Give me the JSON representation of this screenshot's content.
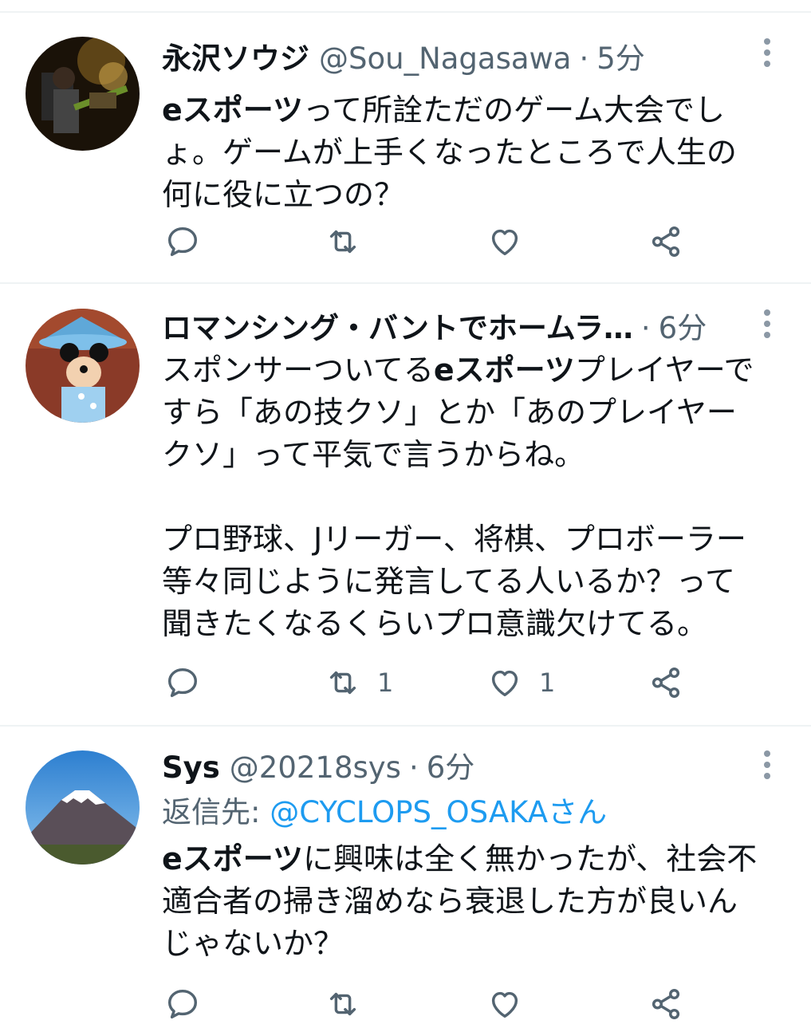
{
  "tweets": [
    {
      "display_name": "永沢ソウジ",
      "handle": "@Sou_Nagasawa",
      "separator": "·",
      "time": "5分",
      "reply_label": "",
      "reply_handle": "",
      "lines": [
        [
          {
            "t": "eスポーツ",
            "b": true
          },
          {
            "t": "って所詮ただのゲーム大会でし",
            "b": false
          }
        ],
        [
          {
            "t": "ょ。ゲームが上手くなったところで人生の",
            "b": false
          }
        ],
        [
          {
            "t": "何に役に立つの？",
            "b": false
          }
        ]
      ],
      "counts": {
        "reply": "",
        "retweet": "",
        "like": ""
      }
    },
    {
      "display_name": "ロマンシング・バントでホームラ…",
      "handle": "",
      "separator": "·",
      "time": "6分",
      "reply_label": "",
      "reply_handle": "",
      "lines": [
        [
          {
            "t": "スポンサーついてる",
            "b": false
          },
          {
            "t": "eスポーツ",
            "b": true
          },
          {
            "t": "プレイヤーで",
            "b": false
          }
        ],
        [
          {
            "t": "すら「あの技クソ」とか「あのプレイヤー",
            "b": false
          }
        ],
        [
          {
            "t": "クソ」って平気で言うからね。",
            "b": false
          }
        ],
        [],
        [
          {
            "t": "プロ野球、Jリーガー、将棋、プロボーラー",
            "b": false
          }
        ],
        [
          {
            "t": "等々同じように発言してる人いるか？って",
            "b": false
          }
        ],
        [
          {
            "t": "聞きたくなるくらいプロ意識欠けてる。",
            "b": false
          }
        ]
      ],
      "counts": {
        "reply": "",
        "retweet": "1",
        "like": "1"
      }
    },
    {
      "display_name": "Sys",
      "handle": "@20218sys",
      "separator": "·",
      "time": "6分",
      "reply_label": "返信先: ",
      "reply_handle": "@CYCLOPS_OSAKAさん",
      "lines": [
        [
          {
            "t": "eスポーツ",
            "b": true
          },
          {
            "t": "に興味は全く無かったが、社会不",
            "b": false
          }
        ],
        [
          {
            "t": "適合者の掃き溜めなら衰退した方が良いん",
            "b": false
          }
        ],
        [
          {
            "t": "じゃないか？",
            "b": false
          }
        ]
      ],
      "counts": {
        "reply": "",
        "retweet": "",
        "like": ""
      }
    }
  ],
  "icons": {
    "reply": "reply-icon",
    "retweet": "retweet-icon",
    "like": "heart-icon",
    "share": "share-icon",
    "more": "more-vertical-icon"
  },
  "colors": {
    "text": "#0f1419",
    "secondary": "#536471",
    "link": "#1d9bf0",
    "divider": "#eff3f4"
  }
}
